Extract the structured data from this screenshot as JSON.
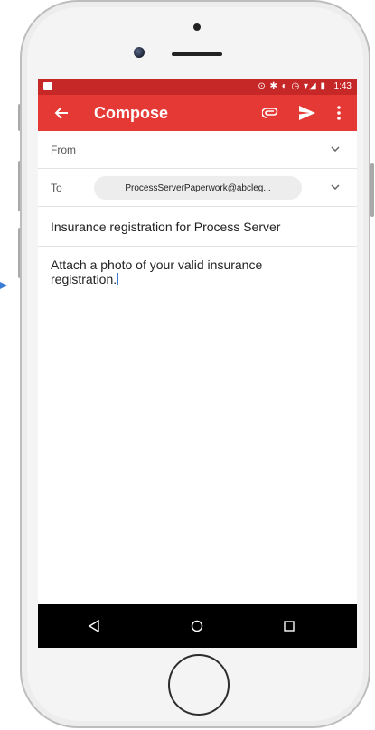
{
  "status_bar": {
    "time": "1:43",
    "icons_text": "⊙ ✱ ◐ ◷ ▾◢ ▮"
  },
  "app_bar": {
    "title": "Compose"
  },
  "compose": {
    "from_label": "From",
    "to_label": "To",
    "to_recipient": "ProcessServerPaperwork@abcleg...",
    "subject": "Insurance registration for Process Server",
    "body": "Attach a photo of your valid insurance registration."
  },
  "colors": {
    "app_bar": "#e53935",
    "status_bar": "#c62828",
    "caret": "#3a7bd5"
  },
  "icons": [
    "back-arrow-icon",
    "attach-icon",
    "send-icon",
    "more-vert-icon",
    "chevron-down-icon",
    "nav-back-icon",
    "nav-home-icon",
    "nav-recents-icon"
  ]
}
